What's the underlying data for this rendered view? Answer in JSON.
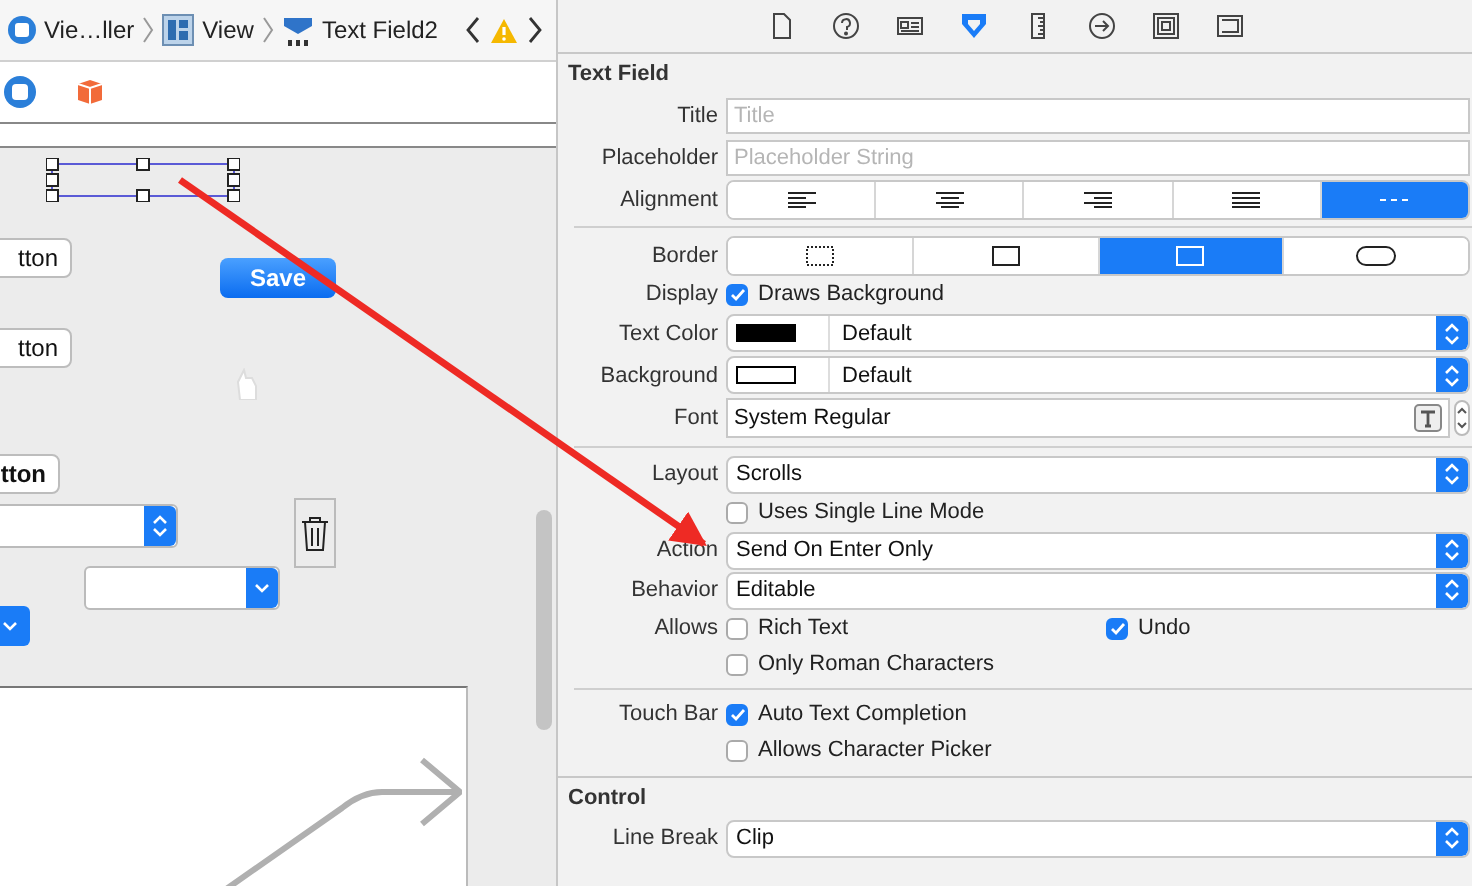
{
  "breadcrumb": [
    {
      "kind": "controller",
      "label": "Vie…ller"
    },
    {
      "kind": "view",
      "label": "View"
    },
    {
      "kind": "textfield",
      "label": "Text Field2"
    }
  ],
  "canvas": {
    "items": [
      {
        "kind": "selected-field"
      },
      {
        "kind": "push",
        "label": "tton"
      },
      {
        "kind": "default",
        "label": "Save"
      },
      {
        "kind": "push",
        "label": "tton"
      },
      {
        "kind": "cursor"
      },
      {
        "kind": "push-bold",
        "label": "tton"
      },
      {
        "kind": "stepper-combo"
      },
      {
        "kind": "trash"
      },
      {
        "kind": "combo"
      },
      {
        "kind": "popup"
      }
    ]
  },
  "inspector": {
    "tabs": [
      {
        "kind": "file",
        "selected": false
      },
      {
        "kind": "help",
        "selected": false
      },
      {
        "kind": "identity",
        "selected": false
      },
      {
        "kind": "attributes",
        "selected": true
      },
      {
        "kind": "size",
        "selected": false
      },
      {
        "kind": "connections",
        "selected": false
      },
      {
        "kind": "bindings",
        "selected": false
      },
      {
        "kind": "effects",
        "selected": false
      }
    ],
    "sections": [
      {
        "title": "Text Field",
        "rows": [
          {
            "kind": "field",
            "label": "Title",
            "placeholder": "Title"
          },
          {
            "kind": "field",
            "label": "Placeholder",
            "placeholder": "Placeholder String"
          },
          {
            "kind": "segmented",
            "label": "Alignment",
            "segments": [
              {
                "kind": "left",
                "selected": false
              },
              {
                "kind": "center",
                "selected": false
              },
              {
                "kind": "right",
                "selected": false
              },
              {
                "kind": "justified",
                "selected": false
              },
              {
                "kind": "natural",
                "selected": true
              }
            ]
          },
          {
            "kind": "divider"
          },
          {
            "kind": "segmented",
            "label": "Border",
            "segments": [
              {
                "kind": "none",
                "selected": false
              },
              {
                "kind": "line",
                "selected": false
              },
              {
                "kind": "bezel",
                "selected": true
              },
              {
                "kind": "rounded",
                "selected": false
              }
            ]
          },
          {
            "kind": "checks",
            "label": "Display",
            "items": [
              {
                "text": "Draws Background",
                "checked": true
              }
            ]
          },
          {
            "kind": "color",
            "label": "Text Color",
            "color": "#000000",
            "value": "Default"
          },
          {
            "kind": "color",
            "label": "Background",
            "color": "#ffffff",
            "value": "Default"
          },
          {
            "kind": "font",
            "label": "Font",
            "value": "System Regular"
          },
          {
            "kind": "divider"
          },
          {
            "kind": "popup",
            "label": "Layout",
            "value": "Scrolls"
          },
          {
            "kind": "checks",
            "items": [
              {
                "text": "Uses Single Line Mode",
                "checked": false
              }
            ]
          },
          {
            "kind": "popup",
            "label": "Action",
            "value": "Send On Enter Only"
          },
          {
            "kind": "popup",
            "label": "Behavior",
            "value": "Editable"
          },
          {
            "kind": "checks",
            "label": "Allows",
            "items": [
              {
                "text": "Rich Text",
                "checked": false
              },
              {
                "text": "Undo",
                "checked": true
              }
            ]
          },
          {
            "kind": "checks",
            "items": [
              {
                "text": "Only Roman Characters",
                "checked": false
              }
            ]
          },
          {
            "kind": "divider"
          },
          {
            "kind": "checks",
            "label": "Touch Bar",
            "items": [
              {
                "text": "Auto Text Completion",
                "checked": true
              }
            ]
          },
          {
            "kind": "checks",
            "items": [
              {
                "text": "Allows Character Picker",
                "checked": false
              }
            ]
          }
        ]
      },
      {
        "title": "Control",
        "rows": [
          {
            "kind": "popup",
            "label": "Line Break",
            "value": "Clip"
          }
        ]
      }
    ]
  }
}
